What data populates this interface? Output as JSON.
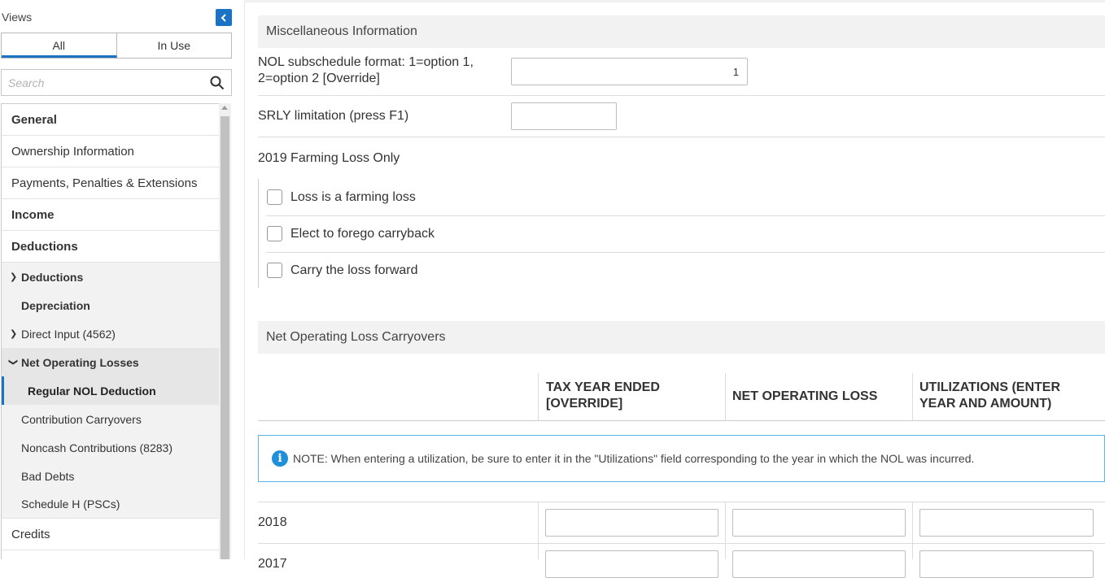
{
  "sidebar": {
    "views_label": "Views",
    "toggle": {
      "all": "All",
      "in_use": "In Use"
    },
    "search_placeholder": "Search",
    "items": [
      {
        "label": "General"
      },
      {
        "label": "Ownership Information"
      },
      {
        "label": "Payments, Penalties & Extensions"
      },
      {
        "label": "Income"
      },
      {
        "label": "Deductions"
      },
      {
        "label": "Deductions"
      },
      {
        "label": "Depreciation"
      },
      {
        "label": "Direct Input (4562)"
      },
      {
        "label": "Net Operating Losses"
      },
      {
        "label": "Regular NOL Deduction"
      },
      {
        "label": "Contribution Carryovers"
      },
      {
        "label": "Noncash Contributions (8283)"
      },
      {
        "label": "Bad Debts"
      },
      {
        "label": "Schedule H (PSCs)"
      },
      {
        "label": "Credits"
      }
    ]
  },
  "misc": {
    "header": "Miscellaneous Information",
    "nol_format_label_1": "NOL subschedule format: 1=option 1,",
    "nol_format_label_2": "2=option 2 [Override]",
    "nol_format_value": "1",
    "srly_label": "SRLY limitation (press F1)",
    "srly_value": "",
    "farming_header": "2019 Farming Loss Only",
    "checkboxes": [
      {
        "label": "Loss is a farming loss",
        "checked": false
      },
      {
        "label": "Elect to forego carryback",
        "checked": false
      },
      {
        "label": "Carry the loss forward",
        "checked": false
      }
    ]
  },
  "nol": {
    "header": "Net Operating Loss Carryovers",
    "columns": {
      "tax_year_1": "TAX YEAR ENDED",
      "tax_year_2": "[OVERRIDE]",
      "net_loss": "NET OPERATING LOSS",
      "util_1": "UTILIZATIONS (ENTER",
      "util_2": "YEAR AND AMOUNT)"
    },
    "note_icon": "info-icon",
    "note": "NOTE: When entering a utilization, be sure to enter it in the \"Utilizations\" field corresponding to the year in which the NOL was incurred.",
    "rows": [
      {
        "year": "2018"
      },
      {
        "year": "2017"
      }
    ]
  },
  "colors": {
    "accent": "#1b73c5",
    "info": "#1f8fd9"
  }
}
